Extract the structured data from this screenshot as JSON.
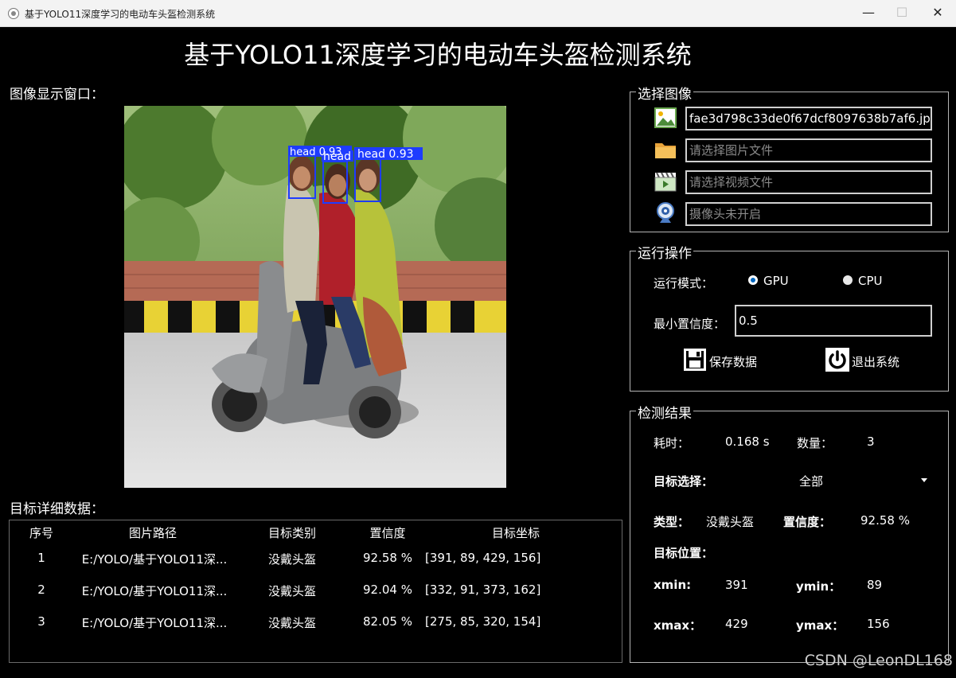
{
  "window": {
    "title": "基于YOLO11深度学习的电动车头盔检测系统",
    "minimize_glyph": "—",
    "maximize_glyph": "☐",
    "close_glyph": "✕"
  },
  "header": {
    "title": "基于YOLO11深度学习的电动车头盔检测系统"
  },
  "image_panel": {
    "label": "图像显示窗口：",
    "detections": [
      {
        "label": "head 0.93"
      },
      {
        "label": "head"
      },
      {
        "label": "head 0.93"
      }
    ]
  },
  "details": {
    "label": "目标详细数据：",
    "columns": [
      "序号",
      "图片路径",
      "目标类别",
      "置信度",
      "目标坐标"
    ],
    "rows": [
      [
        "1",
        "E:/YOLO/基于YOLO11深...",
        "没戴头盔",
        "92.58 %",
        "[391, 89, 429, 156]"
      ],
      [
        "2",
        "E:/YOLO/基于YOLO11深...",
        "没戴头盔",
        "92.04 %",
        "[332, 91, 373, 162]"
      ],
      [
        "3",
        "E:/YOLO/基于YOLO11深...",
        "没戴头盔",
        "82.05 %",
        "[275, 85, 320, 154]"
      ]
    ]
  },
  "select_image": {
    "title": "选择图像",
    "image_file_value": "fae3d798c33de0f67dcf8097638b7af6.jpg",
    "folder_placeholder": "请选择图片文件",
    "video_placeholder": "请选择视频文件",
    "camera_placeholder": "摄像头未开启",
    "icons": [
      "image-icon",
      "folder-icon",
      "video-icon",
      "webcam-icon"
    ]
  },
  "run": {
    "title": "运行操作",
    "mode_label": "运行模式：",
    "gpu_label": "GPU",
    "cpu_label": "CPU",
    "selected_mode": "GPU",
    "conf_label": "最小置信度：",
    "conf_value": "0.5",
    "save_label": "保存数据",
    "exit_label": "退出系统"
  },
  "results": {
    "title": "检测结果",
    "time_label": "耗时：",
    "time_value": "0.168 s",
    "count_label": "数量：",
    "count_value": "3",
    "target_select_label": "目标选择：",
    "target_select_value": "全部",
    "type_label": "类型：",
    "type_value": "没戴头盔",
    "conf_label": "置信度：",
    "conf_value": "92.58 %",
    "position_label": "目标位置：",
    "xmin_label": "xmin:",
    "xmin_value": "391",
    "ymin_label": "ymin：",
    "ymin_value": "89",
    "xmax_label": "xmax：",
    "xmax_value": "429",
    "ymax_label": "ymax：",
    "ymax_value": "156"
  },
  "watermark": "CSDN @LeonDL168",
  "colors": {
    "background": "#000000",
    "box_color": "#1e3cff",
    "radio_selected": "#0067c0"
  }
}
